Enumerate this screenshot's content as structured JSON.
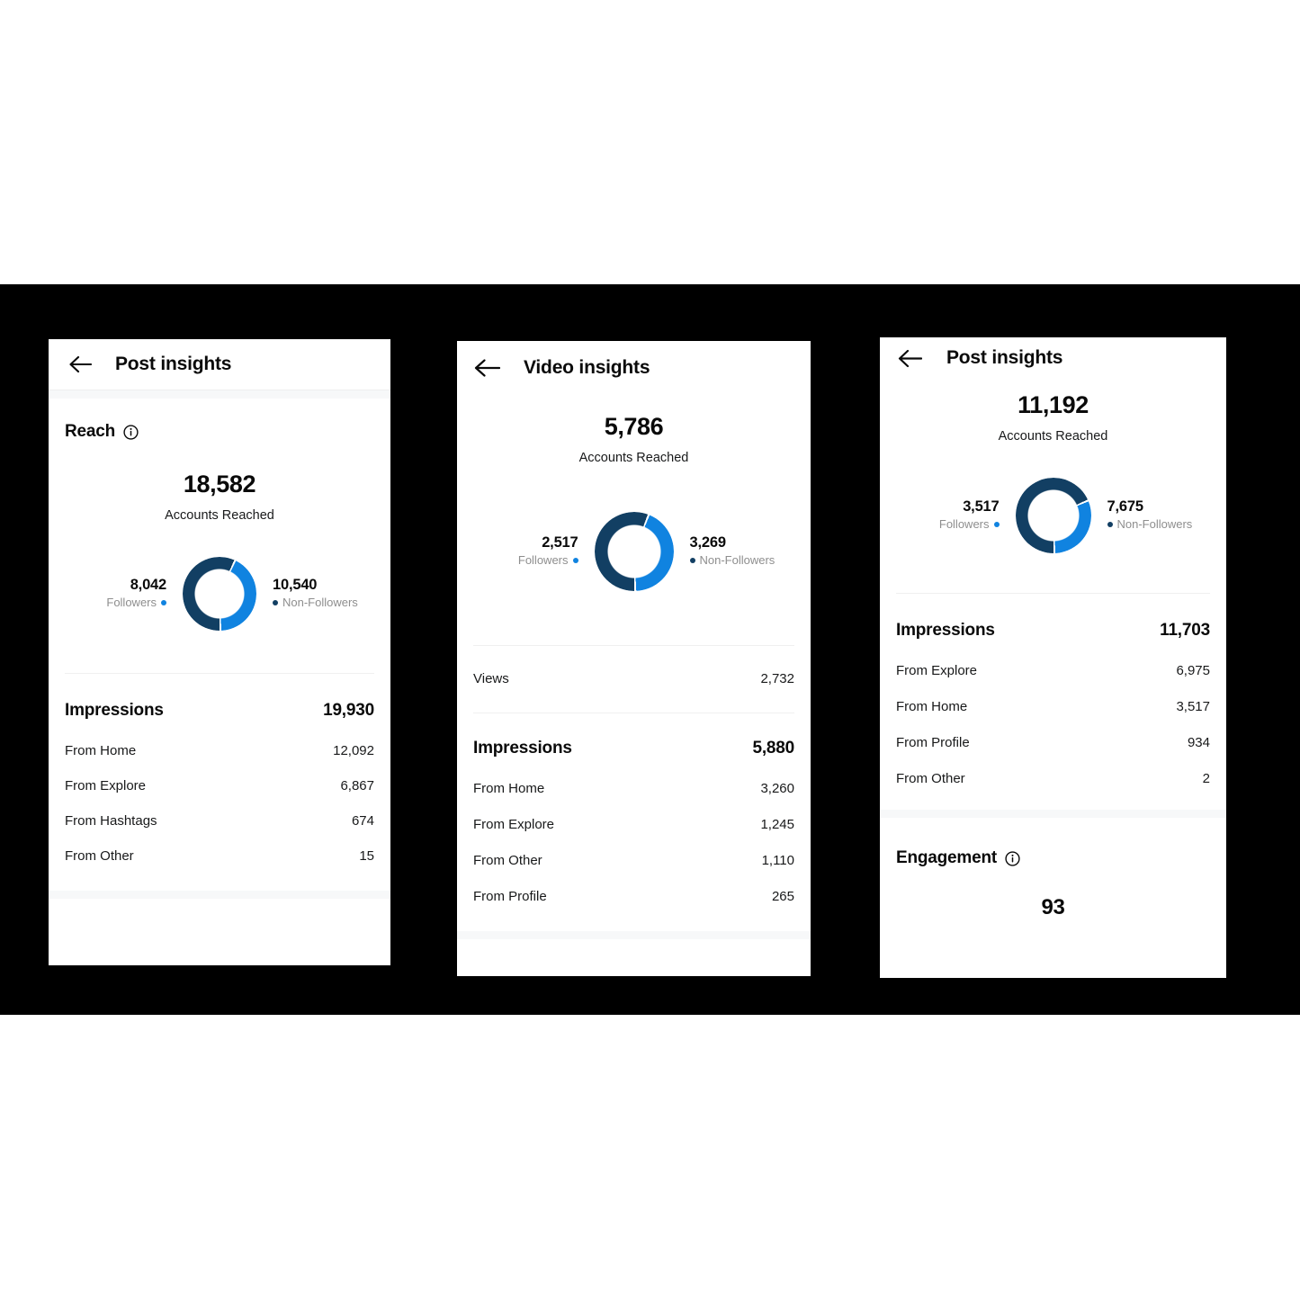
{
  "colors": {
    "followers": "#1083E0",
    "non_followers": "#123F63",
    "page_background": "#ffffff",
    "band_background": "#000000",
    "muted_text": "#8e8e8e",
    "primary_text": "#0a0a0a"
  },
  "panels": [
    {
      "id": "panel-1",
      "header": {
        "title": "Post insights",
        "back_icon": "arrow-left-icon"
      },
      "reach": {
        "section_title": "Reach",
        "info_icon": "info-circle-icon",
        "value": "18,582",
        "label": "Accounts Reached",
        "followers_value": "8,042",
        "followers_label": "Followers",
        "non_followers_value": "10,540",
        "non_followers_label": "Non-Followers"
      },
      "impressions": {
        "label": "Impressions",
        "value": "19,930",
        "rows": [
          {
            "label": "From Home",
            "value": "12,092"
          },
          {
            "label": "From Explore",
            "value": "6,867"
          },
          {
            "label": "From Hashtags",
            "value": "674"
          },
          {
            "label": "From Other",
            "value": "15"
          }
        ]
      }
    },
    {
      "id": "panel-2",
      "header": {
        "title": "Video insights",
        "back_icon": "arrow-left-icon"
      },
      "reach": {
        "value": "5,786",
        "label": "Accounts Reached",
        "followers_value": "2,517",
        "followers_label": "Followers",
        "non_followers_value": "3,269",
        "non_followers_label": "Non-Followers"
      },
      "views": {
        "label": "Views",
        "value": "2,732"
      },
      "impressions": {
        "label": "Impressions",
        "value": "5,880",
        "rows": [
          {
            "label": "From Home",
            "value": "3,260"
          },
          {
            "label": "From Explore",
            "value": "1,245"
          },
          {
            "label": "From Other",
            "value": "1,110"
          },
          {
            "label": "From Profile",
            "value": "265"
          }
        ]
      }
    },
    {
      "id": "panel-3",
      "header": {
        "title": "Post insights",
        "back_icon": "arrow-left-icon"
      },
      "reach": {
        "value": "11,192",
        "label": "Accounts Reached",
        "followers_value": "3,517",
        "followers_label": "Followers",
        "non_followers_value": "7,675",
        "non_followers_label": "Non-Followers"
      },
      "impressions": {
        "label": "Impressions",
        "value": "11,703",
        "rows": [
          {
            "label": "From Explore",
            "value": "6,975"
          },
          {
            "label": "From Home",
            "value": "3,517"
          },
          {
            "label": "From Profile",
            "value": "934"
          },
          {
            "label": "From Other",
            "value": "2"
          }
        ]
      },
      "engagement": {
        "section_title": "Engagement",
        "info_icon": "info-circle-icon",
        "value": "93"
      }
    }
  ],
  "chart_data": [
    {
      "type": "pie",
      "title": "Reach breakdown - Post insights (18,582)",
      "categories": [
        "Followers",
        "Non-Followers"
      ],
      "values": [
        8042,
        10540
      ],
      "colors": [
        "#1083E0",
        "#123F63"
      ],
      "legend": "sides",
      "donut": true
    },
    {
      "type": "pie",
      "title": "Reach breakdown - Video insights (5,786)",
      "categories": [
        "Followers",
        "Non-Followers"
      ],
      "values": [
        2517,
        3269
      ],
      "colors": [
        "#1083E0",
        "#123F63"
      ],
      "legend": "sides",
      "donut": true
    },
    {
      "type": "pie",
      "title": "Reach breakdown - Post insights (11,192)",
      "categories": [
        "Followers",
        "Non-Followers"
      ],
      "values": [
        3517,
        7675
      ],
      "colors": [
        "#1083E0",
        "#123F63"
      ],
      "legend": "sides",
      "donut": true
    }
  ]
}
